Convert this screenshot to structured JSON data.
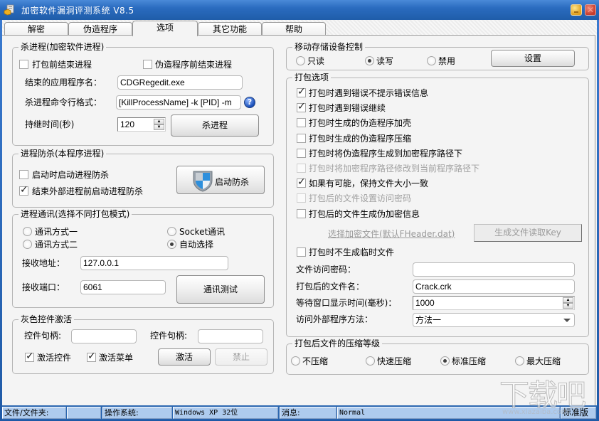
{
  "window": {
    "title": "加密软件漏洞评测系统  V8.5",
    "app_icon": "folder-key-icon",
    "minimize_icon": "minimize-icon",
    "close_icon": "close-icon",
    "close_glyph": "✕"
  },
  "tabs": [
    {
      "label": "解密",
      "active": false
    },
    {
      "label": "伪造程序",
      "active": false
    },
    {
      "label": "选项",
      "active": true
    },
    {
      "label": "其它功能",
      "active": false
    },
    {
      "label": "帮助",
      "active": false
    }
  ],
  "kill_process": {
    "title": "杀进程(加密软件进程)",
    "chk_before_pack": {
      "label": "打包前结束进程",
      "checked": false
    },
    "chk_before_fake": {
      "label": "伪造程序前结束进程",
      "checked": false
    },
    "app_name_label": "结束的应用程序名：",
    "app_name_value": "CDGRegedit.exe",
    "cmdline_label": "杀进程命令行格式：",
    "cmdline_value": "[KillProcessName] -k [PID] -m",
    "help_glyph": "?",
    "duration_label": "持继时间(秒)",
    "duration_value": "120",
    "spin_up": "▲",
    "spin_down": "▼",
    "kill_button": "杀进程"
  },
  "anti_kill": {
    "title": "进程防杀(本程序进程)",
    "chk_on_start": {
      "label": "启动时启动进程防杀",
      "checked": false
    },
    "chk_before_end": {
      "label": "结束外部进程前启动进程防杀",
      "checked": true
    },
    "start_button": "启动防杀",
    "button_icon": "shield-icon"
  },
  "ipc": {
    "title": "进程通讯(选择不同打包模式)",
    "radio_mode1": {
      "label": "通讯方式一",
      "checked": false
    },
    "radio_mode2": {
      "label": "通讯方式二",
      "checked": false
    },
    "radio_socket": {
      "label": "Socket通讯",
      "checked": false
    },
    "radio_auto": {
      "label": "自动选择",
      "checked": true
    },
    "address_label": "接收地址：",
    "address_value": "127.0.0.1",
    "port_label": "接收端口：",
    "port_value": "6061",
    "test_button": "通讯测试"
  },
  "gray_activate": {
    "title": "灰色控件激活",
    "handle1_label": "控件句柄:",
    "handle1_value": "",
    "handle2_label": "控件句柄:",
    "handle2_value": "",
    "chk_controls": {
      "label": "激活控件",
      "checked": true
    },
    "chk_menus": {
      "label": "激活菜单",
      "checked": true
    },
    "activate_button": "激活",
    "disable_button": "禁止"
  },
  "storage": {
    "title": "移动存储设备控制",
    "radio_readonly": {
      "label": "只读",
      "checked": false
    },
    "radio_readwrite": {
      "label": "读写",
      "checked": true
    },
    "radio_disabled": {
      "label": "禁用",
      "checked": false
    },
    "settings_button": "设置"
  },
  "pack_options": {
    "title": "打包选项",
    "checks": [
      {
        "label": "打包时遇到错误不提示错误信息",
        "checked": true,
        "disabled": false
      },
      {
        "label": "打包时遇到错误继续",
        "checked": true,
        "disabled": false
      },
      {
        "label": "打包时生成的伪造程序加壳",
        "checked": false,
        "disabled": false
      },
      {
        "label": "打包时生成的伪造程序压缩",
        "checked": false,
        "disabled": false
      },
      {
        "label": "打包时将伪造程序生成到加密程序路径下",
        "checked": false,
        "disabled": false
      },
      {
        "label": "打包时将加密程序路径修改到当前程序路径下",
        "checked": false,
        "disabled": true
      },
      {
        "label": "如果有可能，保持文件大小一致",
        "checked": true,
        "disabled": false
      },
      {
        "label": "打包后的文件设置访问密码",
        "checked": false,
        "disabled": true
      },
      {
        "label": "打包后的文件生成伪加密信息",
        "checked": false,
        "disabled": false
      }
    ],
    "select_file_link": "选择加密文件(默认FHeader.dat)",
    "gen_key_button": "生成文件读取Key",
    "chk_no_temp": {
      "label": "打包时不生成临时文件",
      "checked": false
    },
    "password_label": "文件访问密码：",
    "password_value": "",
    "filename_label": "打包后的文件名：",
    "filename_value": "Crack.crk",
    "wait_label": "等待窗口显示时间(毫秒)：",
    "wait_value": "1000",
    "method_label": "访问外部程序方法：",
    "method_value": "方法一"
  },
  "compression": {
    "title": "打包后文件的压缩等级",
    "options": [
      {
        "label": "不压缩",
        "checked": false
      },
      {
        "label": "快速压缩",
        "checked": false
      },
      {
        "label": "标准压缩",
        "checked": true
      },
      {
        "label": "最大压缩",
        "checked": false
      }
    ]
  },
  "statusbar": {
    "file_label": "文件/文件夹:",
    "file_value": "",
    "os_label": "操作系统:",
    "os_value": "Windows XP 32位",
    "msg_label": "消息:",
    "msg_value": "Normal",
    "edition": "标准版"
  },
  "watermark": {
    "text": "下载吧",
    "url": "www.xiazaiba.com"
  }
}
